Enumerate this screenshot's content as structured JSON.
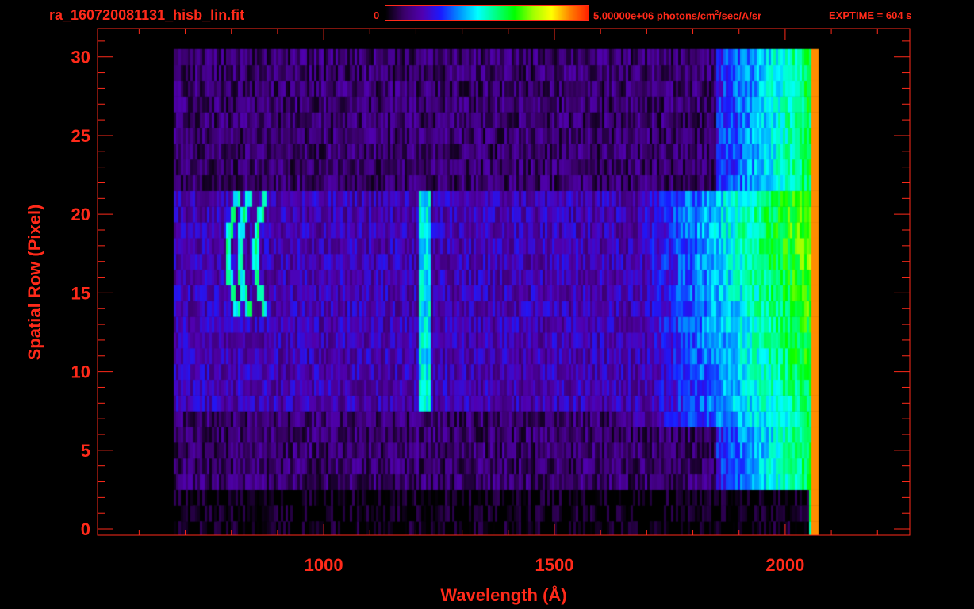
{
  "header": {
    "file_title": "ra_160720081131_hisb_lin.fit",
    "colorbar_min": "0",
    "colorbar_max_prefix": "5.00000e+06 photons/cm",
    "colorbar_max_exp": "2",
    "colorbar_max_suffix": "/sec/A/sr",
    "exptime": "EXPTIME = 604 s"
  },
  "colors": {
    "axis": "#ff2a1a",
    "background": "#000000",
    "colormap": [
      "#000000",
      "#3a006a",
      "#5000b0",
      "#1a1aff",
      "#0090ff",
      "#00ffff",
      "#00ff80",
      "#00ff00",
      "#a0ff00",
      "#ffff00",
      "#ff8000",
      "#ff2000"
    ]
  },
  "chart_data": {
    "type": "heatmap",
    "xlabel": "Wavelength (Å)",
    "ylabel": "Spatial Row (Pixel)",
    "xlim": [
      510,
      2270
    ],
    "ylim": [
      -0.4,
      31.8
    ],
    "xticks": [
      1000,
      1500,
      2000
    ],
    "yticks": [
      0,
      5,
      10,
      15,
      20,
      25,
      30
    ],
    "colorbar_range": [
      0,
      5000000
    ],
    "colorbar_units": "photons/cm^2/sec/A/sr",
    "exposure_time_s": 604,
    "wavelength_coverage": [
      670,
      2070
    ],
    "rows": 31,
    "slit_illuminated_rows": [
      8,
      21
    ],
    "features": [
      {
        "label": "short-wavelength arc emission",
        "wavelength_range": [
          770,
          880
        ],
        "rows": [
          14,
          21
        ]
      },
      {
        "label": "Lyman-alpha line",
        "wavelength": 1216,
        "rows": [
          8,
          21
        ]
      },
      {
        "label": "continuum rise",
        "wavelength_range": [
          1550,
          2060
        ],
        "rows": [
          7,
          21
        ],
        "peak_row": 19
      }
    ]
  }
}
